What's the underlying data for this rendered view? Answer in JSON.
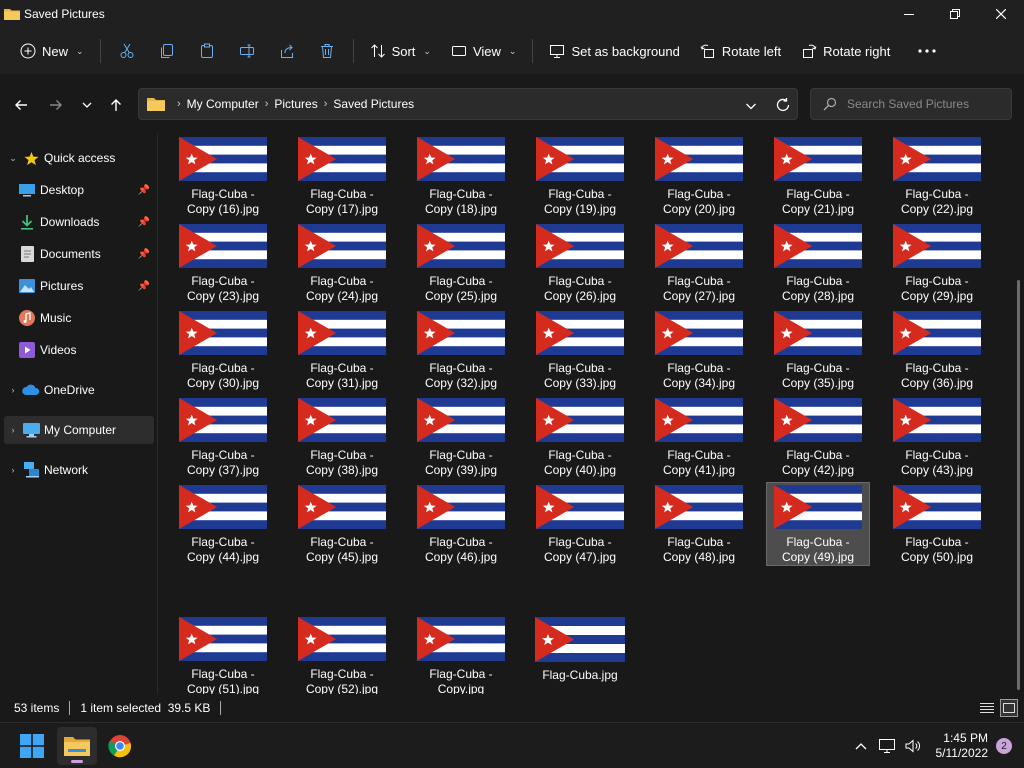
{
  "window": {
    "title": "Saved Pictures"
  },
  "toolbar": {
    "new_label": "New",
    "sort_label": "Sort",
    "view_label": "View",
    "set_background_label": "Set as background",
    "rotate_left_label": "Rotate left",
    "rotate_right_label": "Rotate right"
  },
  "address": {
    "crumbs": [
      "My Computer",
      "Pictures",
      "Saved Pictures"
    ]
  },
  "search": {
    "placeholder": "Search Saved Pictures"
  },
  "sidebar": {
    "items": [
      {
        "label": "Quick access",
        "icon": "star-icon"
      },
      {
        "label": "Desktop",
        "icon": "desktop-icon"
      },
      {
        "label": "Downloads",
        "icon": "download-icon"
      },
      {
        "label": "Documents",
        "icon": "document-icon"
      },
      {
        "label": "Pictures",
        "icon": "pictures-icon"
      },
      {
        "label": "Music",
        "icon": "music-icon"
      },
      {
        "label": "Videos",
        "icon": "video-icon"
      },
      {
        "label": "OneDrive",
        "icon": "cloud-icon"
      },
      {
        "label": "My Computer",
        "icon": "computer-icon"
      },
      {
        "label": "Network",
        "icon": "network-icon"
      }
    ]
  },
  "files": [
    {
      "line1": "Flag-Cuba -",
      "line2": "Copy (16).jpg"
    },
    {
      "line1": "Flag-Cuba -",
      "line2": "Copy (17).jpg"
    },
    {
      "line1": "Flag-Cuba -",
      "line2": "Copy (18).jpg"
    },
    {
      "line1": "Flag-Cuba -",
      "line2": "Copy (19).jpg"
    },
    {
      "line1": "Flag-Cuba -",
      "line2": "Copy (20).jpg"
    },
    {
      "line1": "Flag-Cuba -",
      "line2": "Copy (21).jpg"
    },
    {
      "line1": "Flag-Cuba -",
      "line2": "Copy (22).jpg"
    },
    {
      "line1": "Flag-Cuba -",
      "line2": "Copy (23).jpg"
    },
    {
      "line1": "Flag-Cuba -",
      "line2": "Copy (24).jpg"
    },
    {
      "line1": "Flag-Cuba -",
      "line2": "Copy (25).jpg"
    },
    {
      "line1": "Flag-Cuba -",
      "line2": "Copy (26).jpg"
    },
    {
      "line1": "Flag-Cuba -",
      "line2": "Copy (27).jpg"
    },
    {
      "line1": "Flag-Cuba -",
      "line2": "Copy (28).jpg"
    },
    {
      "line1": "Flag-Cuba -",
      "line2": "Copy (29).jpg"
    },
    {
      "line1": "Flag-Cuba -",
      "line2": "Copy (30).jpg"
    },
    {
      "line1": "Flag-Cuba -",
      "line2": "Copy (31).jpg"
    },
    {
      "line1": "Flag-Cuba -",
      "line2": "Copy (32).jpg"
    },
    {
      "line1": "Flag-Cuba -",
      "line2": "Copy (33).jpg"
    },
    {
      "line1": "Flag-Cuba -",
      "line2": "Copy (34).jpg"
    },
    {
      "line1": "Flag-Cuba -",
      "line2": "Copy (35).jpg"
    },
    {
      "line1": "Flag-Cuba -",
      "line2": "Copy (36).jpg"
    },
    {
      "line1": "Flag-Cuba -",
      "line2": "Copy (37).jpg"
    },
    {
      "line1": "Flag-Cuba -",
      "line2": "Copy (38).jpg"
    },
    {
      "line1": "Flag-Cuba -",
      "line2": "Copy (39).jpg"
    },
    {
      "line1": "Flag-Cuba -",
      "line2": "Copy (40).jpg"
    },
    {
      "line1": "Flag-Cuba -",
      "line2": "Copy (41).jpg"
    },
    {
      "line1": "Flag-Cuba -",
      "line2": "Copy (42).jpg"
    },
    {
      "line1": "Flag-Cuba -",
      "line2": "Copy (43).jpg"
    },
    {
      "line1": "Flag-Cuba -",
      "line2": "Copy (44).jpg"
    },
    {
      "line1": "Flag-Cuba -",
      "line2": "Copy (45).jpg"
    },
    {
      "line1": "Flag-Cuba -",
      "line2": "Copy (46).jpg"
    },
    {
      "line1": "Flag-Cuba -",
      "line2": "Copy (47).jpg"
    },
    {
      "line1": "Flag-Cuba -",
      "line2": "Copy (48).jpg"
    },
    {
      "line1": "Flag-Cuba -",
      "line2": "Copy (49).jpg"
    },
    {
      "line1": "Flag-Cuba -",
      "line2": "Copy (50).jpg"
    },
    {
      "line1": "Flag-Cuba -",
      "line2": "Copy (51).jpg"
    },
    {
      "line1": "Flag-Cuba -",
      "line2": "Copy (52).jpg"
    },
    {
      "line1": "Flag-Cuba -",
      "line2": "Copy.jpg"
    },
    {
      "line1": "Flag-Cuba.jpg",
      "line2": ""
    }
  ],
  "status": {
    "item_count": "53 items",
    "selection": "1 item selected  39.5 KB"
  },
  "clock": {
    "time": "1:45 PM",
    "date": "5/11/2022"
  },
  "notifications": {
    "count": "2"
  },
  "colors": {
    "flag_blue": "#1f3a93",
    "flag_red": "#d52b1e",
    "accent": "#c9a3d9"
  }
}
